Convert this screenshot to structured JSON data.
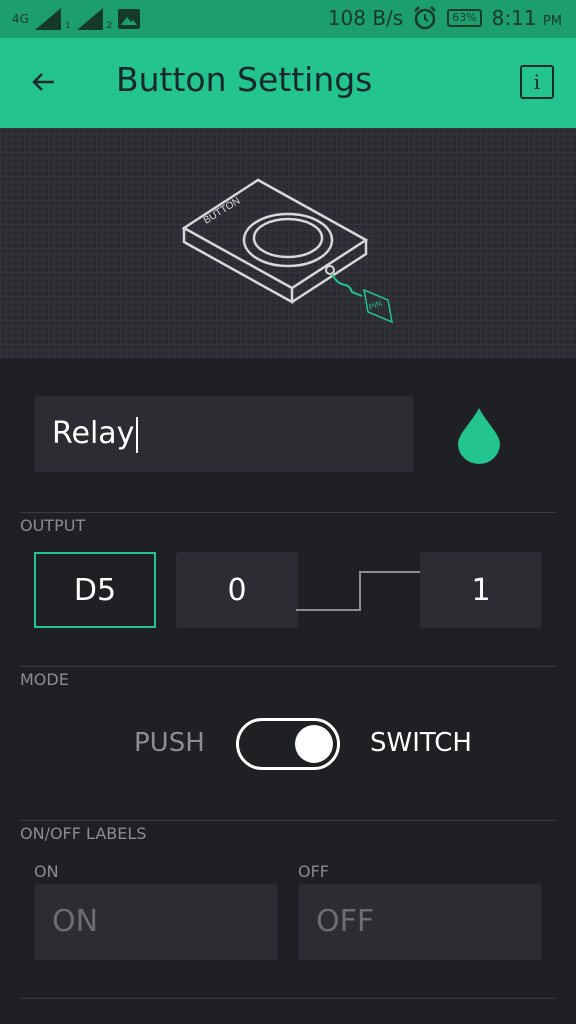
{
  "statusbar": {
    "network": "4G",
    "sim1": "1",
    "sim2": "2",
    "speed": "108 B/s",
    "battery": "63%",
    "time": "8:11",
    "ampm": "PM"
  },
  "appbar": {
    "title": "Button Settings",
    "info_label": "i"
  },
  "hero": {
    "device_label": "BUTTON",
    "pin_label": "PIN"
  },
  "name_field": {
    "value": "Relay"
  },
  "output": {
    "section_label": "OUTPUT",
    "pin": "D5",
    "low": "0",
    "high": "1"
  },
  "mode": {
    "section_label": "MODE",
    "push_label": "PUSH",
    "switch_label": "SWITCH",
    "selected": "SWITCH"
  },
  "labels": {
    "section_label": "ON/OFF LABELS",
    "on_caption": "ON",
    "off_caption": "OFF",
    "on_placeholder": "ON",
    "off_placeholder": "OFF"
  },
  "colors": {
    "accent": "#23c48e",
    "status_bar": "#1c9e6d",
    "background": "#1f2024",
    "field": "#2b2d32"
  },
  "icons": {
    "back": "arrow-left-icon",
    "info": "info-icon",
    "color": "water-drop-icon",
    "alarm": "alarm-icon",
    "image": "image-icon"
  }
}
